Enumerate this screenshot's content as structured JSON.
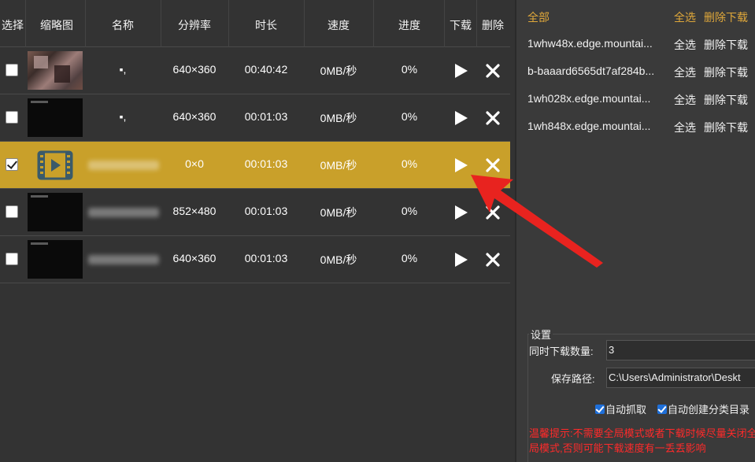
{
  "table": {
    "headers": {
      "select": "选择",
      "thumbnail": "缩略图",
      "name": "名称",
      "resolution": "分辨率",
      "duration": "时长",
      "speed": "速度",
      "progress": "进度",
      "download": "下载",
      "delete": "删除"
    },
    "rows": [
      {
        "checked": false,
        "name": "▪,",
        "resolution": "640×360",
        "duration": "00:40:42",
        "speed": "0MB/秒",
        "progress": "0%"
      },
      {
        "checked": false,
        "name": "▪,",
        "resolution": "640×360",
        "duration": "00:01:03",
        "speed": "0MB/秒",
        "progress": "0%"
      },
      {
        "checked": true,
        "name": "",
        "resolution": "0×0",
        "duration": "00:01:03",
        "speed": "0MB/秒",
        "progress": "0%"
      },
      {
        "checked": false,
        "name": "",
        "resolution": "852×480",
        "duration": "00:01:03",
        "speed": "0MB/秒",
        "progress": "0%"
      },
      {
        "checked": false,
        "name": "",
        "resolution": "640×360",
        "duration": "00:01:03",
        "speed": "0MB/秒",
        "progress": "0%"
      }
    ]
  },
  "sites": {
    "all_label": "全部",
    "select_all_label": "全选",
    "delete_download_label": "删除下载",
    "items": [
      {
        "host": "1whw48x.edge.mountai...",
        "select": "全选",
        "delete": "删除下载"
      },
      {
        "host": "b-baaard6565dt7af284b...",
        "select": "全选",
        "delete": "删除下载"
      },
      {
        "host": "1wh028x.edge.mountai...",
        "select": "全选",
        "delete": "删除下载"
      },
      {
        "host": "1wh848x.edge.mountai...",
        "select": "全选",
        "delete": "删除下载"
      }
    ]
  },
  "settings": {
    "title": "设置",
    "concurrent_label": "同时下载数量:",
    "concurrent_value": "3",
    "save_path_label": "保存路径:",
    "save_path_value": "C:\\Users\\Administrator\\Deskt",
    "auto_capture_label": "自动抓取",
    "auto_capture_checked": true,
    "auto_folder_label": "自动创建分类目录",
    "auto_folder_checked": true,
    "warning": "温馨提示:不需要全局模式或者下载时候尽量关闭全局模式,否则可能下载速度有一丢丢影响"
  },
  "colors": {
    "background": "#333333",
    "selected_row": "#c9a02a",
    "accent_gold": "#e0a83a",
    "warning_red": "#ff2a2a",
    "arrow_red": "#e8231f"
  }
}
